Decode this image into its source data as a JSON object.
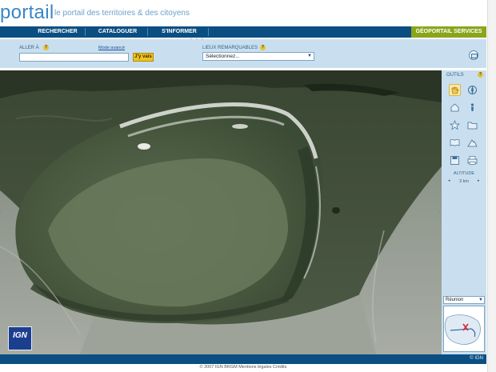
{
  "header": {
    "logo": "portail",
    "tagline": "le portail des territoires & des citoyens"
  },
  "nav": {
    "items": [
      "RECHERCHER",
      "CATALOGUER",
      "S'INFORMER"
    ],
    "services": "GÉOPORTAIL SERVICES",
    "grip": "▲▲▲"
  },
  "search": {
    "goto_label": "ALLER À",
    "advanced_link": "Mode avancé",
    "goto_button": "J'y vais",
    "goto_value": "",
    "places_label": "LIEUX REMARQUABLES",
    "places_selected": "Sélectionnez..."
  },
  "tools": {
    "title": "OUTILS",
    "icons": [
      "hand-icon",
      "compass-icon",
      "house-icon",
      "person-icon",
      "star-icon",
      "folder-icon",
      "books-icon",
      "mountain-icon",
      "save-icon",
      "print-icon"
    ],
    "altitude_label": "ALTITUDE",
    "altitude_value": "3 km",
    "region_selected": "Réunion"
  },
  "map": {
    "logo_text": "IGN"
  },
  "footer": {
    "ign": "© IGN",
    "copyright": "© 2007 IGN BRGM Mentions légales Crédits"
  },
  "colors": {
    "nav_bg": "#0b4f82",
    "services_bg": "#8aa51c",
    "panel_bg": "#c9dfef",
    "accent": "#3b86c4"
  }
}
